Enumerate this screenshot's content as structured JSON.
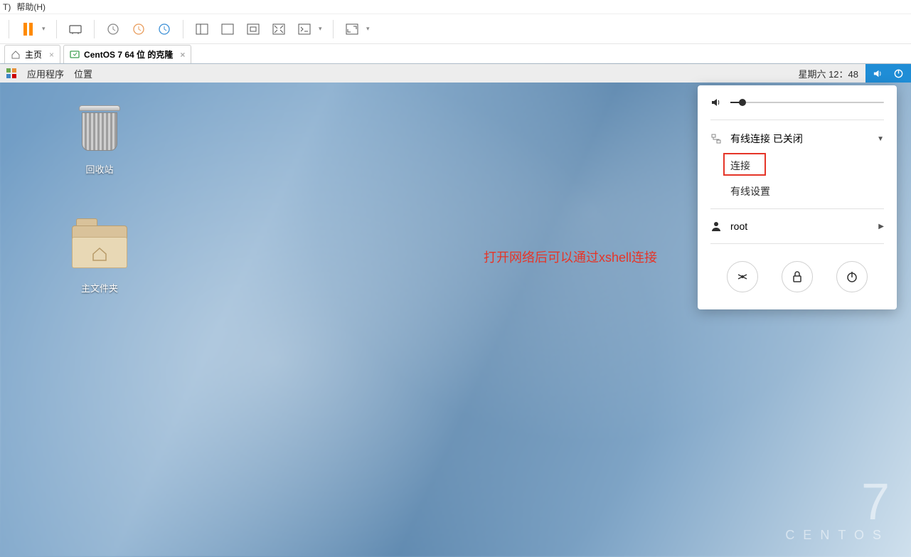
{
  "vmware": {
    "menu_t_fragment": "T)",
    "menu_help": "帮助(H)",
    "tabs": {
      "home": "主页",
      "vm": "CentOS 7 64 位 的克隆"
    }
  },
  "gnome": {
    "apps": "应用程序",
    "places": "位置",
    "clock": "星期六 12：48"
  },
  "desktop": {
    "trash": "回收站",
    "home": "主文件夹"
  },
  "centos": {
    "version": "7",
    "name": "CENTOS"
  },
  "annotation": "打开网络后可以通过xshell连接",
  "sysmenu": {
    "wired_title": "有线连接 已关闭",
    "connect": "连接",
    "wired_settings": "有线设置",
    "user": "root"
  }
}
